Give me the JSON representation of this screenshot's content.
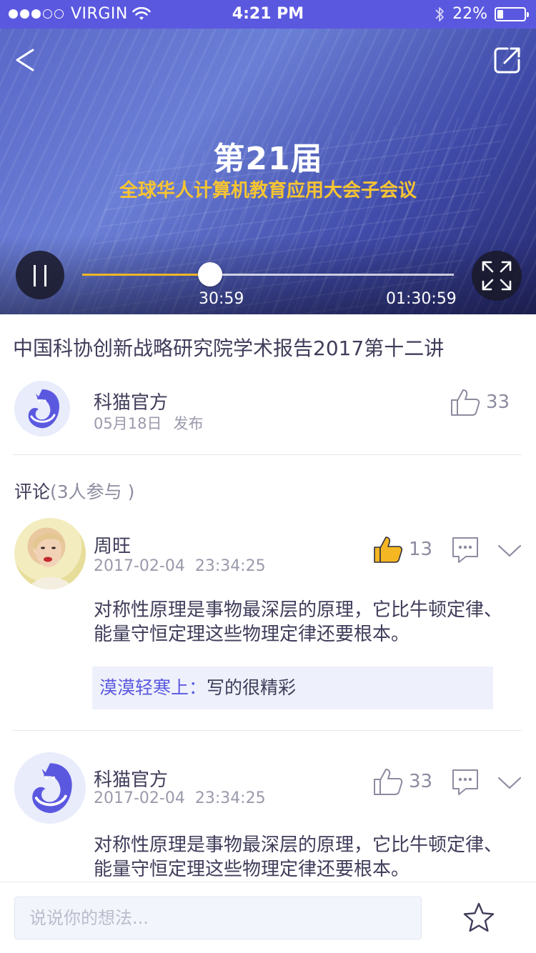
{
  "status_bar": {
    "carrier": "VIRGIN",
    "time": "4:21 PM",
    "battery": "22%",
    "battery_level": 0.22
  },
  "video": {
    "title_main": "第21届",
    "title_sub": "全球华人计算机教育应用大会子会议",
    "current_time": "30:59",
    "total_time": "01:30:59",
    "progress": 0.3434,
    "accent_color": "#f5b623"
  },
  "article": {
    "title": "中国科协创新战略研究院学术报告2017第十二讲",
    "author_name": "科猫官方",
    "publish_date": "05月18日",
    "publish_label": "发布",
    "like_count": "33"
  },
  "comments_section": {
    "title": "评论",
    "participants": "(3人参与 )"
  },
  "comments": [
    {
      "name": "周旺",
      "date": "2017-02-04",
      "time": "23:34:25",
      "likes": "13",
      "liked": true,
      "text": "对称性原理是事物最深层的原理，它比牛顿定律、能量守恒定理这些物理定律还要根本。",
      "reply_author": "漠漠轻寒上",
      "reply_sep": "：",
      "reply_text": "写的很精彩"
    },
    {
      "name": "科猫官方",
      "date": "2017-02-04",
      "time": "23:34:25",
      "likes": "33",
      "liked": false,
      "text": "对称性原理是事物最深层的原理，它比牛顿定律、能量守恒定理这些物理定律还要根本。"
    }
  ],
  "bottom_bar": {
    "input_placeholder": "说说你的想法..."
  },
  "colors": {
    "brand": "#5b58e0",
    "accent": "#f5b623",
    "text_primary": "#3f3d5a",
    "text_secondary": "#9a9aac"
  }
}
